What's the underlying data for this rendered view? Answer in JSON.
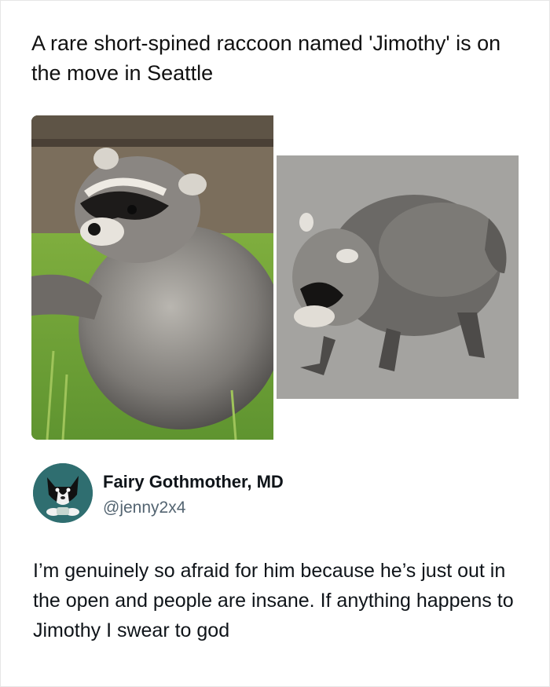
{
  "post": {
    "headline": "A rare short-spined raccoon named 'Jimothy' is on the move in Seattle"
  },
  "photos": {
    "left": {
      "icon": "raccoon-sitting-photo"
    },
    "right": {
      "icon": "raccoon-walking-photo"
    }
  },
  "tweet": {
    "author_name": "Fairy Gothmother, MD",
    "handle": "@jenny2x4",
    "avatar_icon": "dog-avatar",
    "text": "I’m genuinely so afraid for him because he’s just out in the open and people are insane. If anything happens to Jimothy I swear to god"
  },
  "colors": {
    "text_primary": "#0f1419",
    "text_secondary": "#536471",
    "avatar_bg": "#2f6e70"
  }
}
